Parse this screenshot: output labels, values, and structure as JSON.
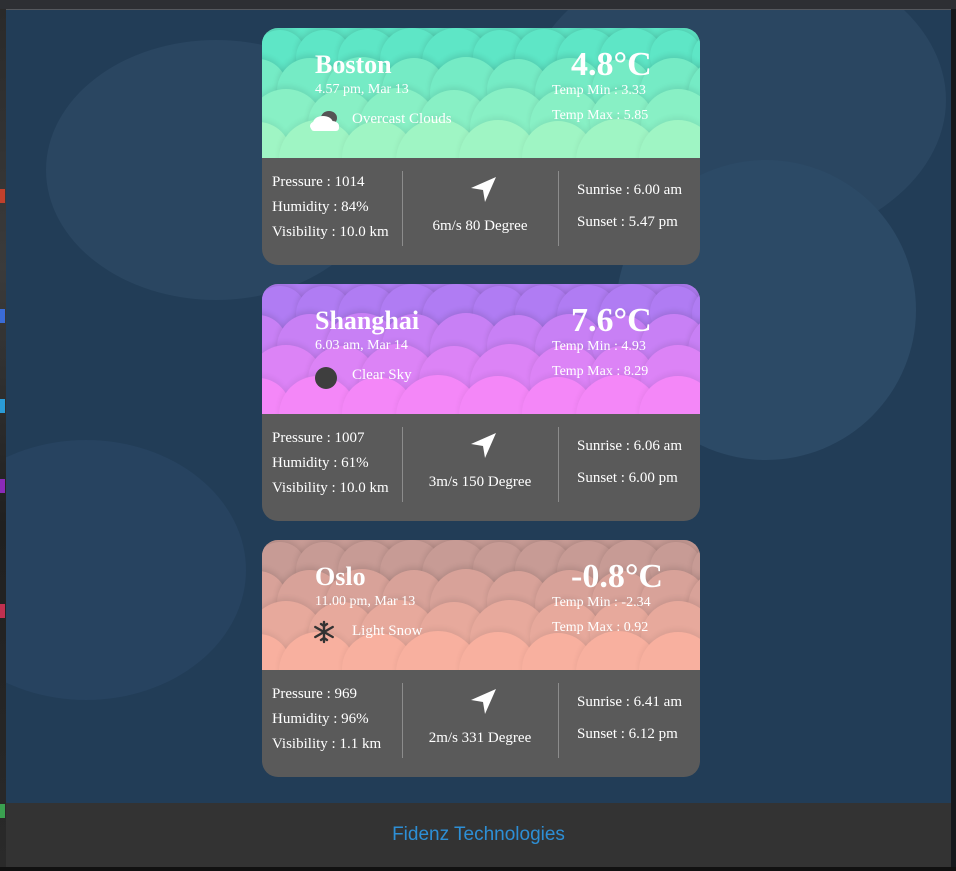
{
  "footer": {
    "company": "Fidenz Technologies"
  },
  "cities": [
    {
      "name": "Boston",
      "datetime": "4.57 pm, Mar 13",
      "condition": "Overcast Clouds",
      "condition_icon": "overcast-clouds-icon",
      "temp": "4.8°C",
      "temp_min": "Temp Min : 3.33",
      "temp_max": "Temp Max : 5.85",
      "pressure": "Pressure : 1014",
      "humidity": "Humidity : 84%",
      "visibility": "Visibility : 10.0 km",
      "wind": "6m/s 80 Degree",
      "sunrise": "Sunrise : 6.00 am",
      "sunset": "Sunset : 5.47 pm",
      "color_top": "#5ee6c6",
      "color_bottom": "#9ff5c4"
    },
    {
      "name": "Shanghai",
      "datetime": "6.03 am, Mar 14",
      "condition": "Clear Sky",
      "condition_icon": "clear-sky-icon",
      "temp": "7.6°C",
      "temp_min": "Temp Min : 4.93",
      "temp_max": "Temp Max : 8.29",
      "pressure": "Pressure : 1007",
      "humidity": "Humidity : 61%",
      "visibility": "Visibility : 10.0 km",
      "wind": "3m/s 150 Degree",
      "sunrise": "Sunrise : 6.06 am",
      "sunset": "Sunset : 6.00 pm",
      "color_top": "#b07cf3",
      "color_bottom": "#f487f8"
    },
    {
      "name": "Oslo",
      "datetime": "11.00 pm, Mar 13",
      "condition": "Light Snow",
      "condition_icon": "snowflake-icon",
      "temp": "-0.8°C",
      "temp_min": "Temp Min : -2.34",
      "temp_max": "Temp Max : 0.92",
      "pressure": "Pressure : 969",
      "humidity": "Humidity : 96%",
      "visibility": "Visibility : 1.1 km",
      "wind": "2m/s 331 Degree",
      "sunrise": "Sunrise : 6.41 am",
      "sunset": "Sunset : 6.12 pm",
      "color_top": "#c79b95",
      "color_bottom": "#f8b09f"
    }
  ]
}
